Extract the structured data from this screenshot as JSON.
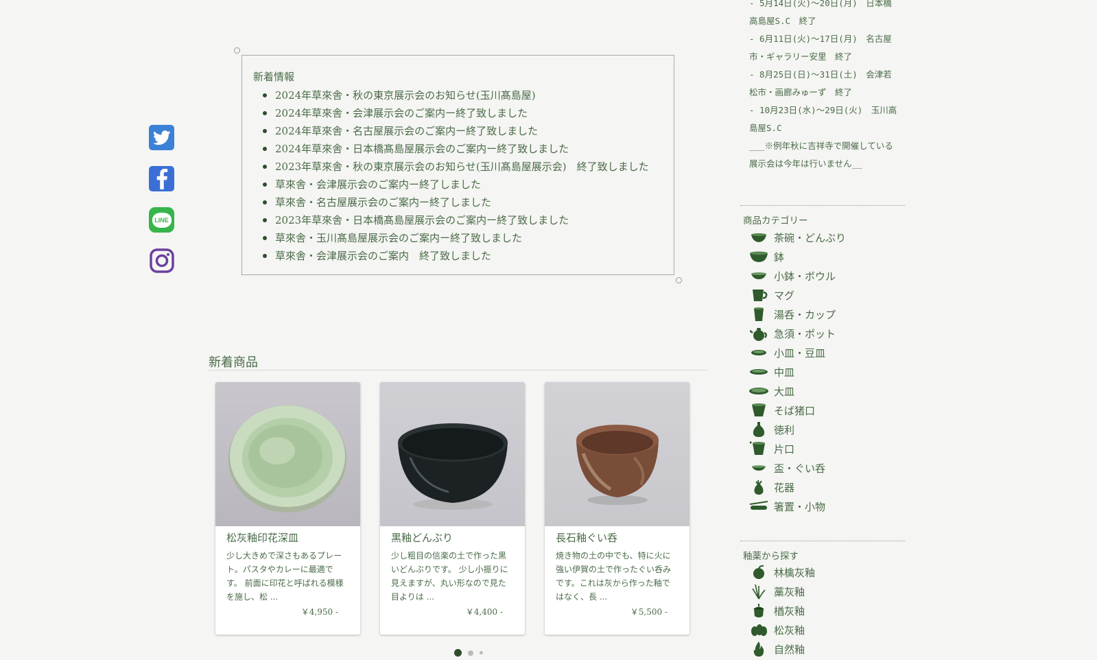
{
  "social": {
    "twitter_icon": "twitter-icon",
    "facebook_icon": "facebook-icon",
    "line_icon": "line-icon",
    "line_label": "LINE",
    "instagram_icon": "instagram-icon"
  },
  "news": {
    "title": "新着情報",
    "items": [
      "2024年草來舎・秋の東京展示会のお知らせ(玉川髙島屋)",
      "2024年草來舎・会津展示会のご案内ー終了致しました",
      "2024年草來舎・名古屋展示会のご案内ー終了致しました",
      "2024年草來舎・日本橋髙島屋展示会のご案内ー終了致しました",
      "2023年草來舎・秋の東京展示会のお知らせ(玉川髙島屋展示会)　終了致しました",
      "草來舎・会津展示会のご案内ー終了しました",
      "草來舎・名古屋展示会のご案内ー終了しました",
      "2023年草來舎・日本橋髙島屋展示会のご案内ー終了致しました",
      "草來舎・玉川髙島屋展示会のご案内ー終了致しました",
      "草來舎・会津展示会のご案内　終了致しました"
    ]
  },
  "new_products": {
    "title": "新着商品",
    "items": [
      {
        "name": "松灰釉印花深皿",
        "desc": "少し大きめで深さもあるプレート。パスタやカレーに最適です。 前面に印花と呼ばれる模様を施し、松 ...",
        "price": "￥4,950 -"
      },
      {
        "name": "黒釉どんぶり",
        "desc": "少し粗目の信楽の土で作った黒いどんぶりです。 少し小振りに見えますが、丸い形なので見た目よりは ...",
        "price": "￥4,400 -"
      },
      {
        "name": "長石釉ぐい呑",
        "desc": "焼き物の土の中でも、特に火に強い伊賀の土で作ったぐい呑みです。これは灰から作った釉ではなく、長 ...",
        "price": "￥5,500 -"
      }
    ]
  },
  "schedule": [
    "- 5月14日(火)〜20日(月)　日本橋高島屋S.C　終了",
    "- 6月11日(火)〜17日(月)　名古屋市・ギャラリー安里　終了",
    "- 8月25日(日)〜31日(土)　会津若松市・画廊みゅーず　終了",
    "- 10月23日(水)〜29日(火)　玉川高島屋S.C",
    "___※例年秋に吉祥寺で開催している展示会は今年は行いません__"
  ],
  "categories": {
    "title": "商品カテゴリー",
    "items": [
      {
        "label": "茶碗・どんぶり",
        "icon": "bowl-icon"
      },
      {
        "label": "鉢",
        "icon": "deep-bowl-icon"
      },
      {
        "label": "小鉢・ボウル",
        "icon": "small-bowl-icon"
      },
      {
        "label": "マグ",
        "icon": "mug-icon"
      },
      {
        "label": "湯呑・カップ",
        "icon": "cup-icon"
      },
      {
        "label": "急須・ポット",
        "icon": "teapot-icon"
      },
      {
        "label": "小皿・豆皿",
        "icon": "small-plate-icon"
      },
      {
        "label": "中皿",
        "icon": "medium-plate-icon"
      },
      {
        "label": "大皿",
        "icon": "large-plate-icon"
      },
      {
        "label": "そば猪口",
        "icon": "soba-cup-icon"
      },
      {
        "label": "徳利",
        "icon": "sake-bottle-icon"
      },
      {
        "label": "片口",
        "icon": "katakuchi-icon"
      },
      {
        "label": "盃・ぐい呑",
        "icon": "sake-cup-icon"
      },
      {
        "label": "花器",
        "icon": "vase-icon"
      },
      {
        "label": "箸置・小物",
        "icon": "chopstick-rest-icon"
      }
    ]
  },
  "glazes": {
    "title": "釉薬から探す",
    "items": [
      {
        "label": "林檎灰釉",
        "icon": "apple-icon"
      },
      {
        "label": "藁灰釉",
        "icon": "straw-icon"
      },
      {
        "label": "楢灰釉",
        "icon": "acorn-icon"
      },
      {
        "label": "松灰釉",
        "icon": "pine-icon"
      },
      {
        "label": "自然釉",
        "icon": "flame-icon"
      }
    ]
  },
  "colors": {
    "text": "#4a6b48",
    "icon_green": "#2f5a2c",
    "dot_active": "#2e4d2c",
    "dot_inactive": "#bbbbbb"
  }
}
